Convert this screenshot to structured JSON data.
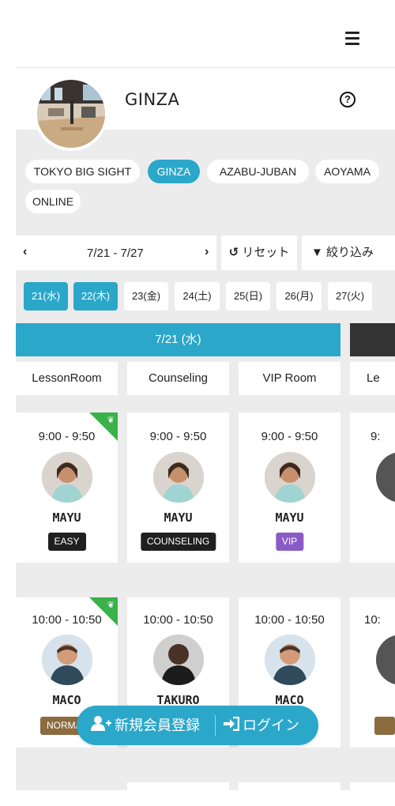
{
  "header": {
    "menu_icon": "hamburger-icon"
  },
  "studio": {
    "title": "GINZA",
    "help_icon": "question-circle-icon",
    "image": "studio-interior-photo"
  },
  "studio_tabs": [
    {
      "label": "TOKYO BIG SIGHT",
      "active": false
    },
    {
      "label": "GINZA",
      "active": true
    },
    {
      "label": "AZABU-JUBAN",
      "active": false
    },
    {
      "label": "AOYAMA",
      "active": false
    },
    {
      "label": "ONLINE",
      "active": false
    }
  ],
  "week_nav": {
    "prev": "‹",
    "range": "7/21 - 7/27",
    "next": "›"
  },
  "reset": {
    "icon": "rotate-left-icon",
    "label": "リセット"
  },
  "filter": {
    "icon": "filter-icon",
    "label": "絞り込み"
  },
  "days": [
    {
      "label": "21(水)",
      "active": true
    },
    {
      "label": "22(木)",
      "active": true
    },
    {
      "label": "23(金)",
      "active": false
    },
    {
      "label": "24(土)",
      "active": false
    },
    {
      "label": "25(日)",
      "active": false
    },
    {
      "label": "26(月)",
      "active": false
    },
    {
      "label": "27(火)",
      "active": false
    }
  ],
  "date_header": "7/21 (水)",
  "rooms": [
    "LessonRoom",
    "Counseling",
    "VIP Room",
    "Le"
  ],
  "slots": [
    {
      "lessons": [
        {
          "time": "9:00 - 9:50",
          "instructor": "MAYU",
          "badge": "EASY",
          "badge_style": "dark",
          "beginner": true
        },
        {
          "time": "9:00 - 9:50",
          "instructor": "MAYU",
          "badge": "COUNSELING",
          "badge_style": "dark",
          "beginner": false
        },
        {
          "time": "9:00 - 9:50",
          "instructor": "MAYU",
          "badge": "VIP",
          "badge_style": "vip",
          "beginner": false
        },
        {
          "time": "9:",
          "instructor": "",
          "badge": "",
          "badge_style": "",
          "beginner": false
        }
      ]
    },
    {
      "lessons": [
        {
          "time": "10:00 - 10:50",
          "instructor": "MACO",
          "badge": "NORMA",
          "badge_style": "brown",
          "beginner": true
        },
        {
          "time": "10:00 - 10:50",
          "instructor": "TAKURO",
          "badge": "",
          "badge_style": "",
          "beginner": false
        },
        {
          "time": "10:00 - 10:50",
          "instructor": "MACO",
          "badge": "",
          "badge_style": "",
          "beginner": false
        },
        {
          "time": "10:",
          "instructor": "",
          "badge": "",
          "badge_style": "brown",
          "beginner": false
        }
      ]
    }
  ],
  "cta": {
    "register_icon": "user-plus-icon",
    "register_label": "新規会員登録",
    "login_icon": "sign-in-icon",
    "login_label": "ログイン"
  },
  "colors": {
    "accent": "#2ba7c9",
    "beginner": "#3bb14a",
    "vip": "#8a5bc5",
    "normal": "#8c6c3e"
  }
}
